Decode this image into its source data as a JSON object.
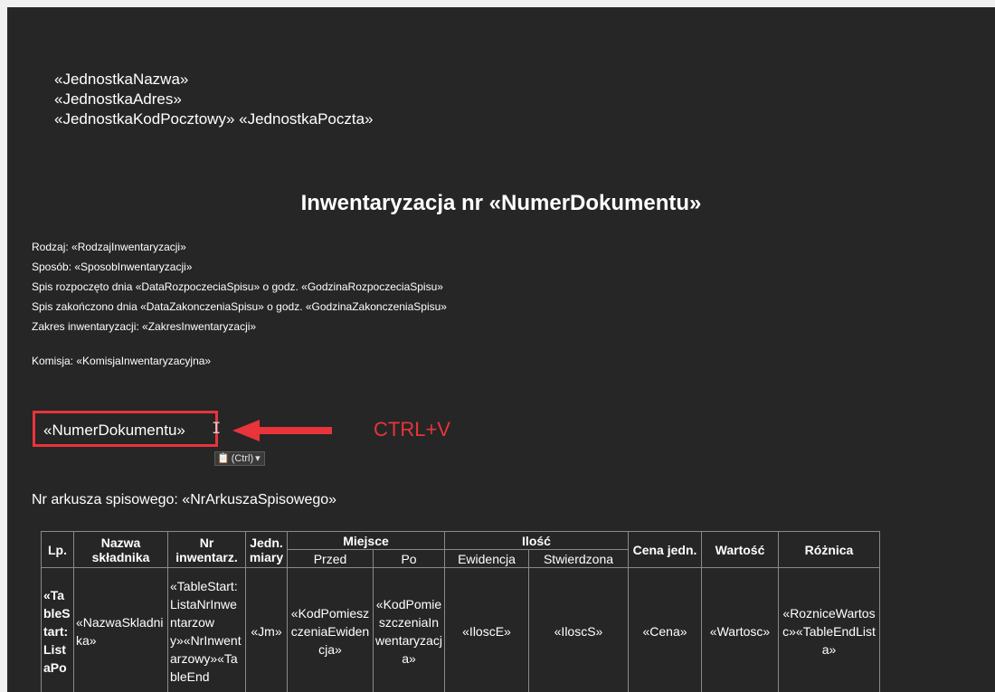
{
  "header": {
    "line1": "«JednostkaNazwa»",
    "line2": "«JednostkaAdres»",
    "line3": "«JednostkaKodPocztowy» «JednostkaPoczta»"
  },
  "title": "Inwentaryzacja nr «NumerDokumentu»",
  "info": {
    "rodzaj": "Rodzaj: «RodzajInwentaryzacji»",
    "sposob": "Sposób: «SposobInwentaryzacji»",
    "rozpoczeto": "Spis rozpoczęto dnia «DataRozpoczeciaSpisu» o godz. «GodzinaRozpoczeciaSpisu»",
    "zakonczono": "Spis zakończono dnia «DataZakonczeniaSpisu» o godz. «GodzinaZakonczeniaSpisu»",
    "zakres": "Zakres inwentaryzacji: «ZakresInwentaryzacji»",
    "komisja": "Komisja: «KomisjaInwentaryzacyjna»"
  },
  "pasted_field": "«NumerDokumentu»",
  "annotation": {
    "text": "CTRL+V",
    "color": "#e8343a"
  },
  "paste_options": {
    "label": "(Ctrl)",
    "dropdown": "▾"
  },
  "arkusz": "Nr arkusza spisowego: «NrArkuszaSpisowego»",
  "table": {
    "headers": {
      "lp": "Lp.",
      "nazwa": "Nazwa składnika",
      "nr": "Nr inwentarz.",
      "jedn": "Jedn. miary",
      "miejsce": "Miejsce",
      "ilosc": "Ilość",
      "cena": "Cena jedn.",
      "wartosc": "Wartość",
      "roznica": "Różnica",
      "przed": "Przed",
      "po": "Po",
      "ewidencja": "Ewidencja",
      "stwierdzona": "Stwierdzona"
    },
    "row": {
      "lp": "«TableStart:ListaPo",
      "nazwa": "«NazwaSkladnika»",
      "nr": "«TableStart:ListaNrInwentarzowy»«NrInwentarzowy»«TableEnd",
      "jedn": "«Jm»",
      "przed": "«KodPomieszczeniaEwidencja»",
      "po": "«KodPomieszczeniaInwentaryzacja»",
      "ewidencja": "«IloscE»",
      "stwierdzona": "«IloscS»",
      "cena": "«Cena»",
      "wartosc": "«Wartosc»",
      "roznica": "«RozniceWartosc»«TableEndLista»"
    }
  },
  "colors": {
    "page_background": "#262626",
    "highlight_box": "#e8343a",
    "text": "#ffffff"
  },
  "icons": [
    "text-cursor-icon",
    "left-arrow-icon",
    "clipboard-icon",
    "dropdown-arrow-icon"
  ]
}
